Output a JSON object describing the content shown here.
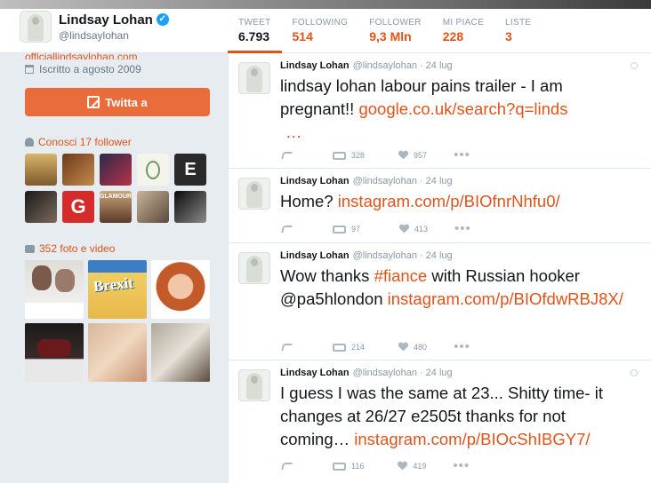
{
  "profile": {
    "name": "Lindsay Lohan",
    "handle": "@lindsaylohan",
    "website_cut": "officiallindsaylohan.com",
    "joined": "Iscritto a agosto 2009"
  },
  "stats": [
    {
      "label": "TWEET",
      "value": "6.793"
    },
    {
      "label": "FOLLOWING",
      "value": "514"
    },
    {
      "label": "FOLLOWER",
      "value": "9,3 Mln"
    },
    {
      "label": "MI PIACE",
      "value": "228"
    },
    {
      "label": "LISTE",
      "value": "3"
    }
  ],
  "compose_button": "Twitta a",
  "followers_title": "Conosci 17 follower",
  "follower_tiles": [
    "",
    "",
    "",
    "",
    "E",
    "",
    "G",
    "GLAMOUR",
    "",
    ""
  ],
  "photos_title": "352 foto e video",
  "photo_tiles": [
    "",
    "Brexit",
    "",
    "",
    "",
    ""
  ],
  "tweets": [
    {
      "name": "Lindsay Lohan",
      "handle": "@lindsaylohan",
      "date": "· 24 lug",
      "text": "lindsay lohan labour pains trailer - I am pregnant!! ",
      "link": "google.co.uk/search?q=linds",
      "link2": "…",
      "retweets": "328",
      "likes": "957"
    },
    {
      "name": "Lindsay Lohan",
      "handle": "@lindsaylohan",
      "date": "· 24 lug",
      "text": "Home? ",
      "link": "instagram.com/p/BIOfnrNhfu0/",
      "retweets": "97",
      "likes": "413"
    },
    {
      "name": "Lindsay Lohan",
      "handle": "@lindsaylohan",
      "date": "· 24 lug",
      "text1": "Wow thanks ",
      "hashtag": "#fiance",
      "text2": " with Russian hooker @pa5hlondon ",
      "link": "instagram.com/p/BIOfdwRBJ8X/",
      "retweets": "214",
      "likes": "480"
    },
    {
      "name": "Lindsay Lohan",
      "handle": "@lindsaylohan",
      "date": "· 24 lug",
      "text": "I guess I was the same at 23... Shitty time- it changes at 26/27  e2505t thanks for not coming… ",
      "link": "instagram.com/p/BIOcShIBGY7/",
      "retweets": "116",
      "likes": "419"
    }
  ]
}
